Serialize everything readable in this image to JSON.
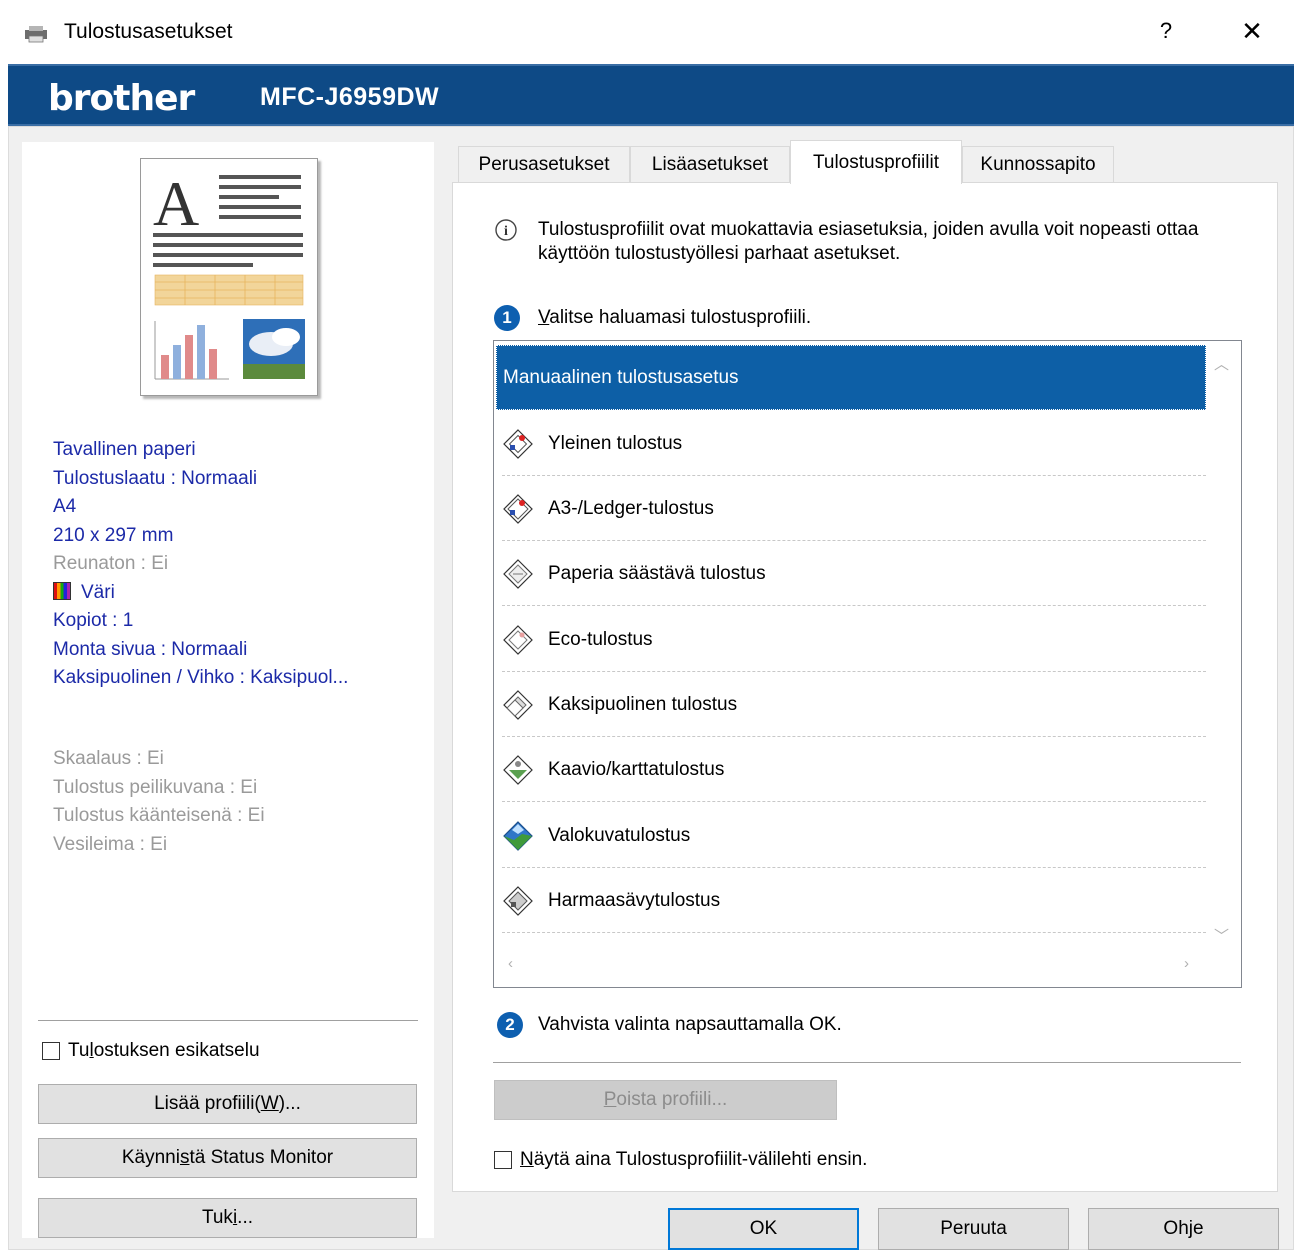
{
  "window": {
    "title": "Tulostusasetukset",
    "help_glyph": "?",
    "close_glyph": "✕"
  },
  "brand": {
    "logo": "brother",
    "model": "MFC-J6959DW"
  },
  "left_panel": {
    "info_primary": [
      "Tavallinen paperi",
      "Tulostuslaatu : Normaali",
      "A4",
      "210 x 297 mm"
    ],
    "borderless": "Reunaton : Ei",
    "color": "Väri",
    "info_secondary": [
      "Kopiot : 1",
      "Monta sivua : Normaali",
      "Kaksipuolinen / Vihko : Kaksipuol..."
    ],
    "info_disabled": [
      "Skaalaus : Ei",
      "Tulostus peilikuvana : Ei",
      "Tulostus käänteisenä : Ei",
      "Vesileima : Ei"
    ],
    "preview_checkbox": {
      "label_before": "Tu",
      "label_underline": "l",
      "label_after": "ostuksen esikatselu",
      "checked": false
    },
    "add_profile_button": {
      "label_before": "Lisää profiili(",
      "label_underline": "W",
      "label_after": ")..."
    },
    "status_monitor_button": {
      "label_before": "Käynni",
      "label_underline": "s",
      "label_after": "tä Status Monitor"
    },
    "support_button": {
      "label_before": "Tuk",
      "label_underline": "i",
      "label_after": "..."
    }
  },
  "tabs": [
    {
      "label": "Perusasetukset",
      "active": false
    },
    {
      "label": "Lisäasetukset",
      "active": false
    },
    {
      "label": "Tulostusprofiilit",
      "active": true
    },
    {
      "label": "Kunnossapito",
      "active": false
    }
  ],
  "profiles_tab": {
    "info_text": "Tulostusprofiilit ovat muokattavia esiasetuksia, joiden avulla voit nopeasti ottaa käyttöön tulostustyöllesi parhaat asetukset.",
    "step1": {
      "badge": "1",
      "label_underline": "V",
      "label_after": "alitse haluamasi tulostusprofiili."
    },
    "profiles": [
      {
        "label": "Manuaalinen tulostusasetus",
        "selected": true,
        "icon": "none"
      },
      {
        "label": "Yleinen tulostus",
        "selected": false,
        "icon": "general-print-icon"
      },
      {
        "label": "A3-/Ledger-tulostus",
        "selected": false,
        "icon": "a3-ledger-print-icon"
      },
      {
        "label": "Paperia säästävä tulostus",
        "selected": false,
        "icon": "paper-saving-icon"
      },
      {
        "label": "Eco-tulostus",
        "selected": false,
        "icon": "eco-print-icon"
      },
      {
        "label": "Kaksipuolinen tulostus",
        "selected": false,
        "icon": "duplex-print-icon"
      },
      {
        "label": "Kaavio/karttatulostus",
        "selected": false,
        "icon": "chart-map-print-icon"
      },
      {
        "label": "Valokuvatulostus",
        "selected": false,
        "icon": "photo-print-icon"
      },
      {
        "label": "Harmaasävytulostus",
        "selected": false,
        "icon": "grayscale-print-icon"
      }
    ],
    "step2": {
      "badge": "2",
      "label": "Vahvista valinta napsauttamalla OK."
    },
    "delete_profile_button": {
      "label_underline": "P",
      "label_after": "oista profiili..."
    },
    "always_show_checkbox": {
      "label_underline": "N",
      "label_after": "äytä aina Tulostusprofiilit-välilehti ensin.",
      "checked": false
    }
  },
  "footer": {
    "ok": "OK",
    "cancel": "Peruuta",
    "help": "Ohje"
  },
  "colors": {
    "brand_bar": "#0e4a86",
    "selection": "#0d5fa6",
    "info_blue": "#1c2aa8",
    "disabled_gray": "#9a9a9a"
  }
}
